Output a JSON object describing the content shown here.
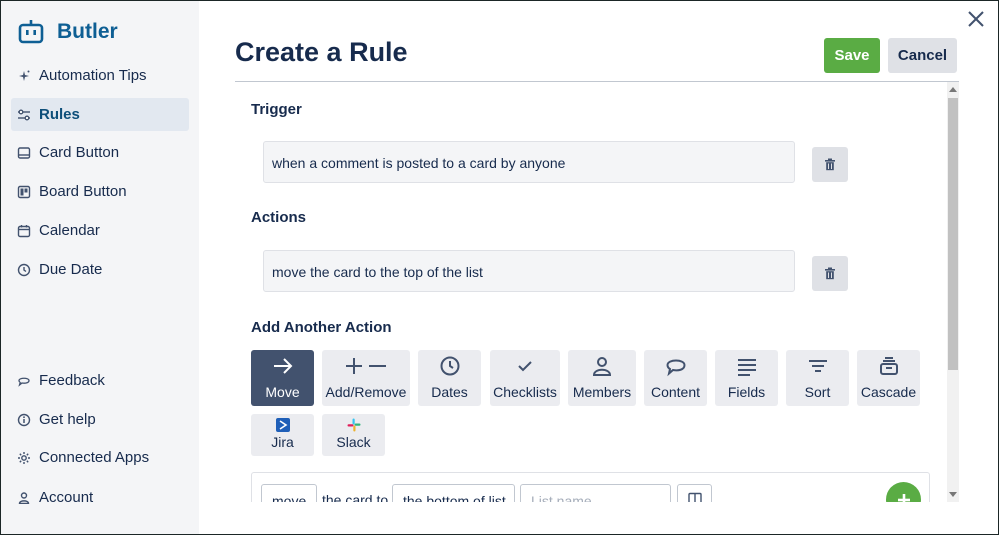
{
  "brand": {
    "name": "Butler"
  },
  "sidebar": {
    "items": [
      {
        "label": "Automation Tips",
        "icon": "sparkle-icon"
      },
      {
        "label": "Rules",
        "icon": "sliders-icon",
        "active": true
      },
      {
        "label": "Card Button",
        "icon": "card-icon"
      },
      {
        "label": "Board Button",
        "icon": "board-icon"
      },
      {
        "label": "Calendar",
        "icon": "calendar-icon"
      },
      {
        "label": "Due Date",
        "icon": "clock-icon"
      },
      {
        "label": "Feedback",
        "icon": "comment-icon"
      },
      {
        "label": "Get help",
        "icon": "info-icon"
      },
      {
        "label": "Connected Apps",
        "icon": "gear-icon"
      },
      {
        "label": "Account",
        "icon": "person-icon"
      }
    ]
  },
  "header": {
    "title": "Create a Rule",
    "save_label": "Save",
    "cancel_label": "Cancel"
  },
  "trigger": {
    "heading": "Trigger",
    "text": "when a comment is posted to a card by anyone"
  },
  "actions": {
    "heading": "Actions",
    "text": "move the card to the top of the list"
  },
  "add_action": {
    "heading": "Add Another Action",
    "types": [
      {
        "label": "Move",
        "icon": "arrow-right-icon",
        "active": true
      },
      {
        "label": "Add/Remove",
        "icon": "plus-minus-icon"
      },
      {
        "label": "Dates",
        "icon": "clock-icon"
      },
      {
        "label": "Checklists",
        "icon": "check-icon"
      },
      {
        "label": "Members",
        "icon": "person-icon"
      },
      {
        "label": "Content",
        "icon": "comment-icon"
      },
      {
        "label": "Fields",
        "icon": "lines-icon"
      },
      {
        "label": "Sort",
        "icon": "sort-icon"
      },
      {
        "label": "Cascade",
        "icon": "cascade-icon"
      },
      {
        "label": "Jira",
        "icon": "jira-icon"
      },
      {
        "label": "Slack",
        "icon": "slack-icon"
      }
    ]
  },
  "builder": {
    "verb": "move",
    "text1": "the card to",
    "position": "the bottom of list",
    "list_placeholder": "List name"
  },
  "colors": {
    "accent": "#0e5f94",
    "save": "#5aac44",
    "active_tile": "#42526e"
  }
}
